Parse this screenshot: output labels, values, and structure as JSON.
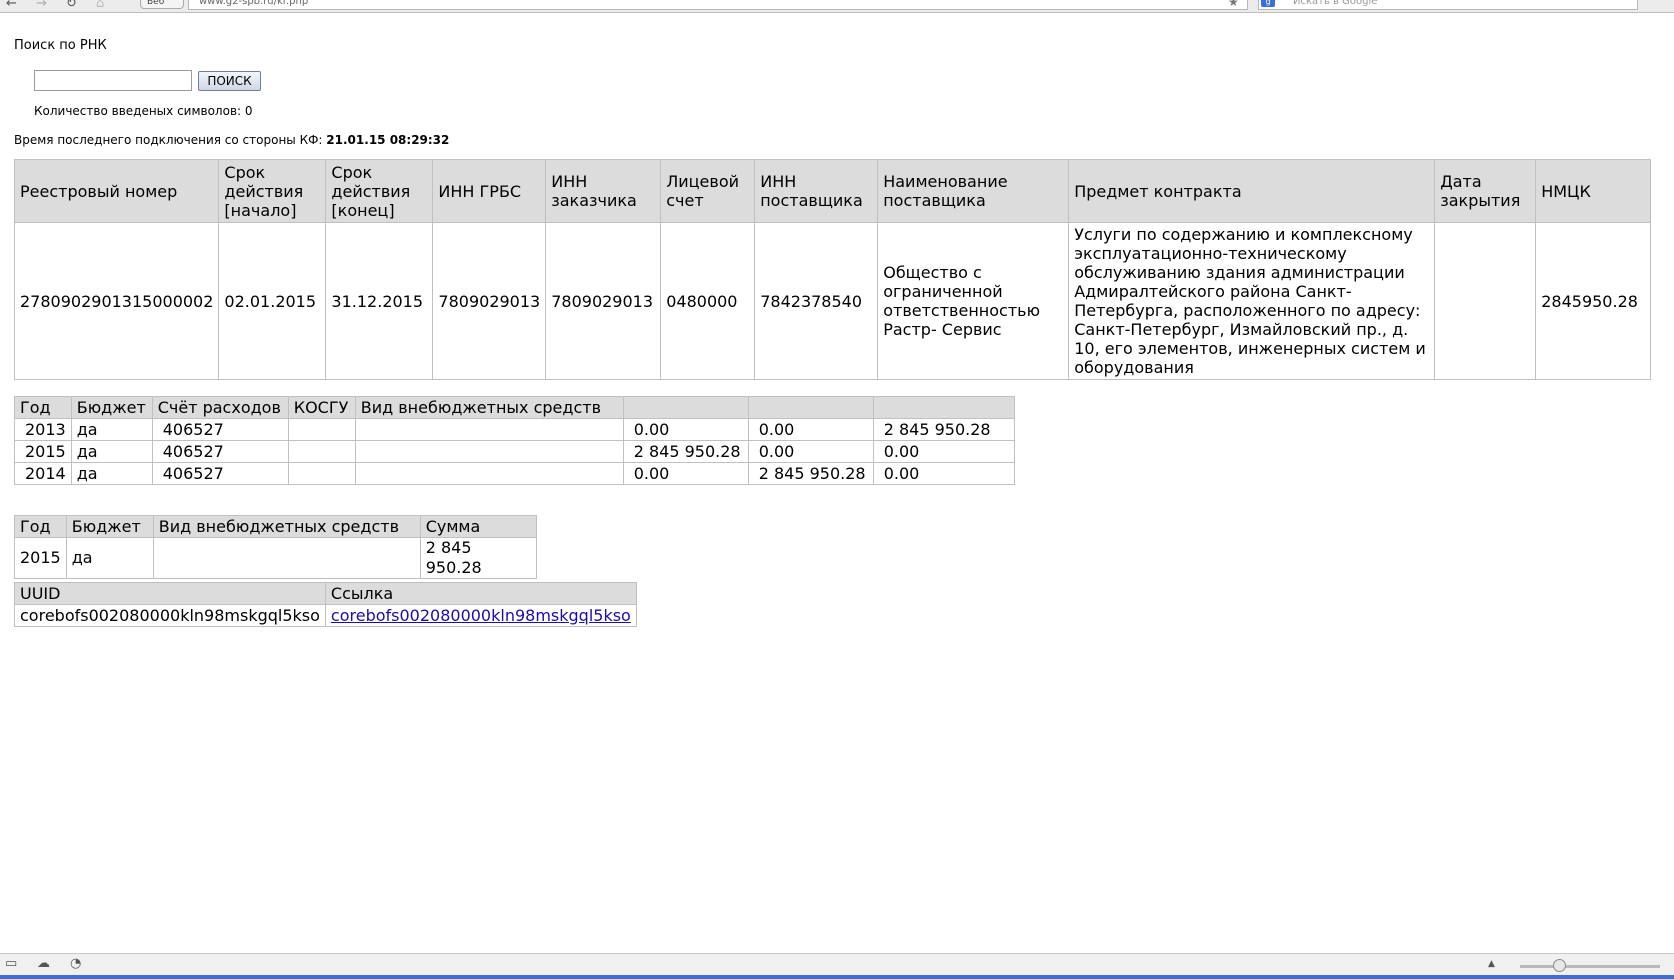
{
  "browser": {
    "back_icon": "←",
    "forward_icon": "→",
    "reload_icon": "↻",
    "home_icon": "⌂",
    "site_badge": "Веб",
    "url": "www.g2-spb.ru/kr.php",
    "search_placeholder": "Искать в Google",
    "star_icon": "★",
    "google_icon": "g"
  },
  "page": {
    "title": "Поиск по РНК",
    "search_button": "ПОИСК",
    "search_value": "",
    "char_count": "Количество введеных символов: 0",
    "last_connection_label": "Время последнего подключения со стороны КФ:",
    "last_connection_value": "21.01.15 08:29:32"
  },
  "main_table": {
    "headers": [
      "Реестровый номер",
      "Срок действия [начало]",
      "Срок действия [конец]",
      "ИНН ГРБС",
      "ИНН заказчика",
      "Лицевой счет",
      "ИНН поставщика",
      "Наименование поставщика",
      "Предмет контракта",
      "Дата закрытия",
      "НМЦК"
    ],
    "row": [
      "2780902901315000002",
      "02.01.2015",
      "31.12.2015",
      "7809029013",
      "7809029013",
      "0480000",
      "7842378540",
      "Общество с ограниченной ответственностью Растр- Сервис",
      "Услуги по содержанию и комплексному эксплуатационно-техническому обслуживанию здания администрации Адмиралтейского района Санкт-Петербурга, расположенного по адресу: Санкт-Петербург, Измайловский пр., д. 10, его элементов, инженерных систем и оборудования",
      "",
      "2845950.28"
    ]
  },
  "finance_table": {
    "headers": [
      "Год",
      "Бюджет",
      "Счёт расходов",
      "КОСГУ",
      "Вид внебюджетных средств",
      "",
      "",
      ""
    ],
    "rows": [
      [
        "2013",
        "да",
        "406527",
        "",
        "",
        "0.00",
        "0.00",
        "2 845 950.28"
      ],
      [
        "2015",
        "да",
        "406527",
        "",
        "",
        "2 845 950.28",
        "0.00",
        "0.00"
      ],
      [
        "2014",
        "да",
        "406527",
        "",
        "",
        "0.00",
        "2 845 950.28",
        "0.00"
      ]
    ]
  },
  "sum_table": {
    "headers": [
      "Год",
      "Бюджет",
      "Вид внебюджетных средств",
      "Сумма"
    ],
    "rows": [
      [
        "2015",
        "да",
        "",
        "2 845 950.28"
      ]
    ]
  },
  "uuid_table": {
    "headers": [
      "UUID",
      "Ссылка"
    ],
    "uuid": "corebofs002080000kln98mskgql5kso",
    "link": "corebofs002080000kln98mskgql5kso"
  },
  "status_bar": {
    "icons": [
      "▭",
      "☁",
      "◔"
    ],
    "arrow": "▲"
  }
}
